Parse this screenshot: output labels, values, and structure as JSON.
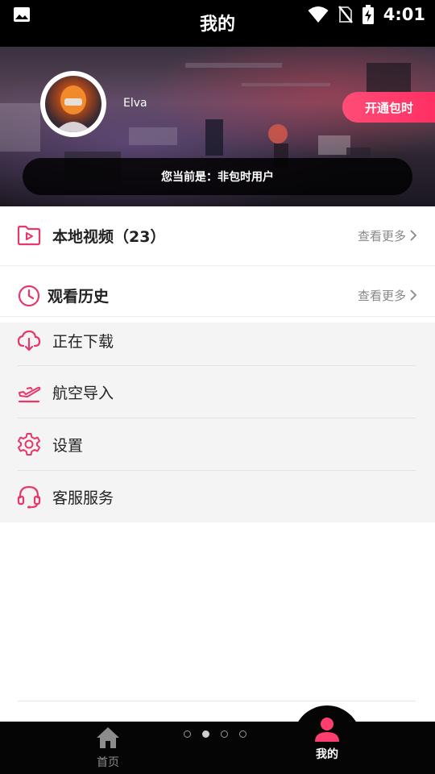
{
  "status_bar": {
    "time": "4:01",
    "icons": [
      "image-icon",
      "wifi-icon",
      "no-sim-icon",
      "battery-charging-icon"
    ]
  },
  "header": {
    "title": "我的"
  },
  "profile": {
    "username": "Elva",
    "vip_button_label": "开通包时",
    "membership_status": "您当前是：非包时用户"
  },
  "sections": {
    "local_videos": {
      "label": "本地视频（23）",
      "more_label": "查看更多",
      "icon": "folder-play-icon"
    },
    "watch_history": {
      "label": "观看历史",
      "more_label": "查看更多",
      "icon": "clock-icon"
    }
  },
  "menu": {
    "items": [
      {
        "label": "正在下载",
        "icon": "cloud-download-icon"
      },
      {
        "label": "航空导入",
        "icon": "airplane-import-icon"
      },
      {
        "label": "设置",
        "icon": "gear-icon"
      },
      {
        "label": "客服服务",
        "icon": "headset-icon"
      }
    ]
  },
  "bottom_nav": {
    "home_label": "首页",
    "me_label": "我的",
    "page_dots": 4,
    "active_dot": 2
  },
  "colors": {
    "accent": "#e8386a",
    "vip_gradient_start": "#ff4d78",
    "vip_gradient_end": "#ff2e62",
    "top_bar": "#000000",
    "bottom_nav": "#050505"
  }
}
